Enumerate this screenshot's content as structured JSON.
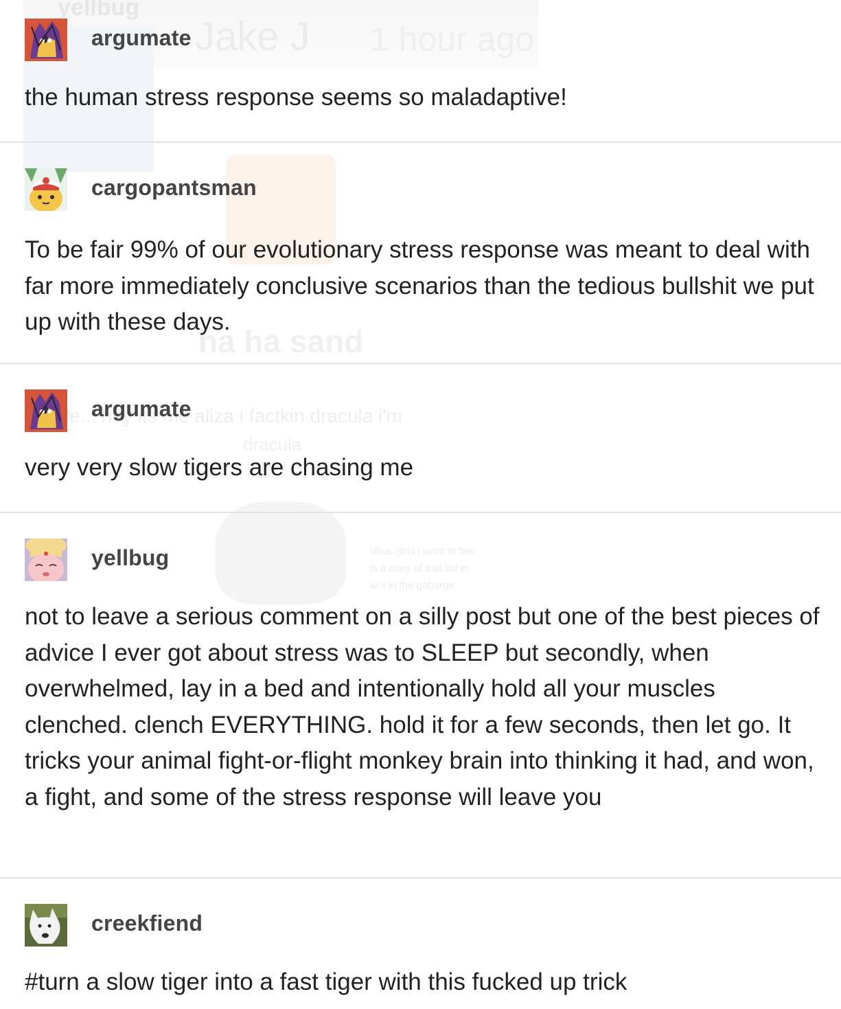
{
  "posts": [
    {
      "username": "argumate",
      "avatar_icon": "argumate-avatar-icon",
      "text": "the human stress response seems so maladaptive!"
    },
    {
      "username": "cargopantsman",
      "avatar_icon": "pikachu-avatar-icon",
      "text": "To be fair 99% of our evolutionary stress response was meant to deal with far more immediately conclusive scenarios than the tedious bullshit we put up with these days."
    },
    {
      "username": "argumate",
      "avatar_icon": "argumate-avatar-icon",
      "text": "very very slow tigers are chasing me"
    },
    {
      "username": "yellbug",
      "avatar_icon": "sailor-moon-avatar-icon",
      "text": "not to leave a serious comment on a silly post but one of the best pieces of advice I ever got about stress was to SLEEP but secondly, when overwhelmed, lay in a bed and intentionally hold all your muscles clenched. clench EVERYTHING. hold it for a few seconds, then let go. It tricks your animal fight-or-flight monkey brain into thinking it had, and won, a fight, and some of the stress response will leave you"
    },
    {
      "username": "creekfiend",
      "avatar_icon": "white-dog-avatar-icon",
      "text": "#turn a slow tiger into a fast tiger with this fucked up trick"
    }
  ],
  "background_ghost": {
    "user": "yellbug",
    "name": "Jake J",
    "time": "1 hour ago",
    "haha": "ha ha sand",
    "caption": "ggle... hey its me aliza i factkin dracula i'm",
    "caption2": "dracula",
    "small_lines": [
      "uhou girls i want to hav",
      "is a copy of that list in",
      "w it in the gabarge"
    ]
  },
  "colors": {
    "text": "#222222",
    "username": "#444444",
    "divider": "#e4e4e4"
  }
}
